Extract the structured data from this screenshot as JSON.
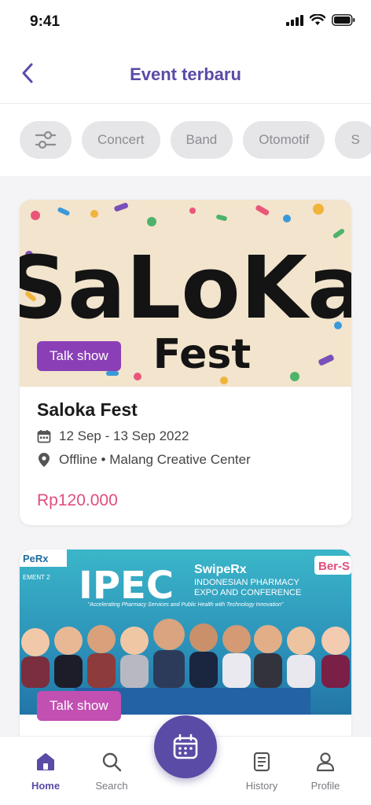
{
  "status_bar": {
    "time": "9:41"
  },
  "header": {
    "title": "Event terbaru",
    "back_icon": "chevron-left-icon"
  },
  "filters": {
    "filter_icon": "sliders-icon",
    "chips": [
      "Concert",
      "Band",
      "Otomotif",
      "S"
    ]
  },
  "events": [
    {
      "name": "Saloka Fest",
      "date": "12 Sep - 13 Sep 2022",
      "location": "Offline • Malang Creative Center",
      "price": "Rp120.000",
      "category": "Talk show",
      "banner": {
        "logo_line1": "SaLoKa",
        "logo_line2": "Fest"
      }
    },
    {
      "category": "Talk show",
      "banner": {
        "brand": "SwipeRx",
        "title": "IPEC",
        "subtitle_line1": "INDONESIAN PHARMACY",
        "subtitle_line2": "EXPO AND CONFERENCE",
        "tagline": "\"Accelerating Pharmacy Services and Public Health with Technology Innovation\"",
        "badge": "Ber-S",
        "corner_tag": "PeRx",
        "element": "EMENT 2"
      }
    }
  ],
  "bottom_nav": {
    "items": [
      {
        "label": "Home",
        "icon": "home-icon"
      },
      {
        "label": "Search",
        "icon": "search-icon"
      },
      {
        "label": "History",
        "icon": "history-icon"
      },
      {
        "label": "Profile",
        "icon": "profile-icon"
      }
    ],
    "fab_icon": "calendar-icon"
  },
  "colors": {
    "accent": "#5b4aa6",
    "price": "#e04e7c",
    "tag": "#8a3fb6"
  }
}
